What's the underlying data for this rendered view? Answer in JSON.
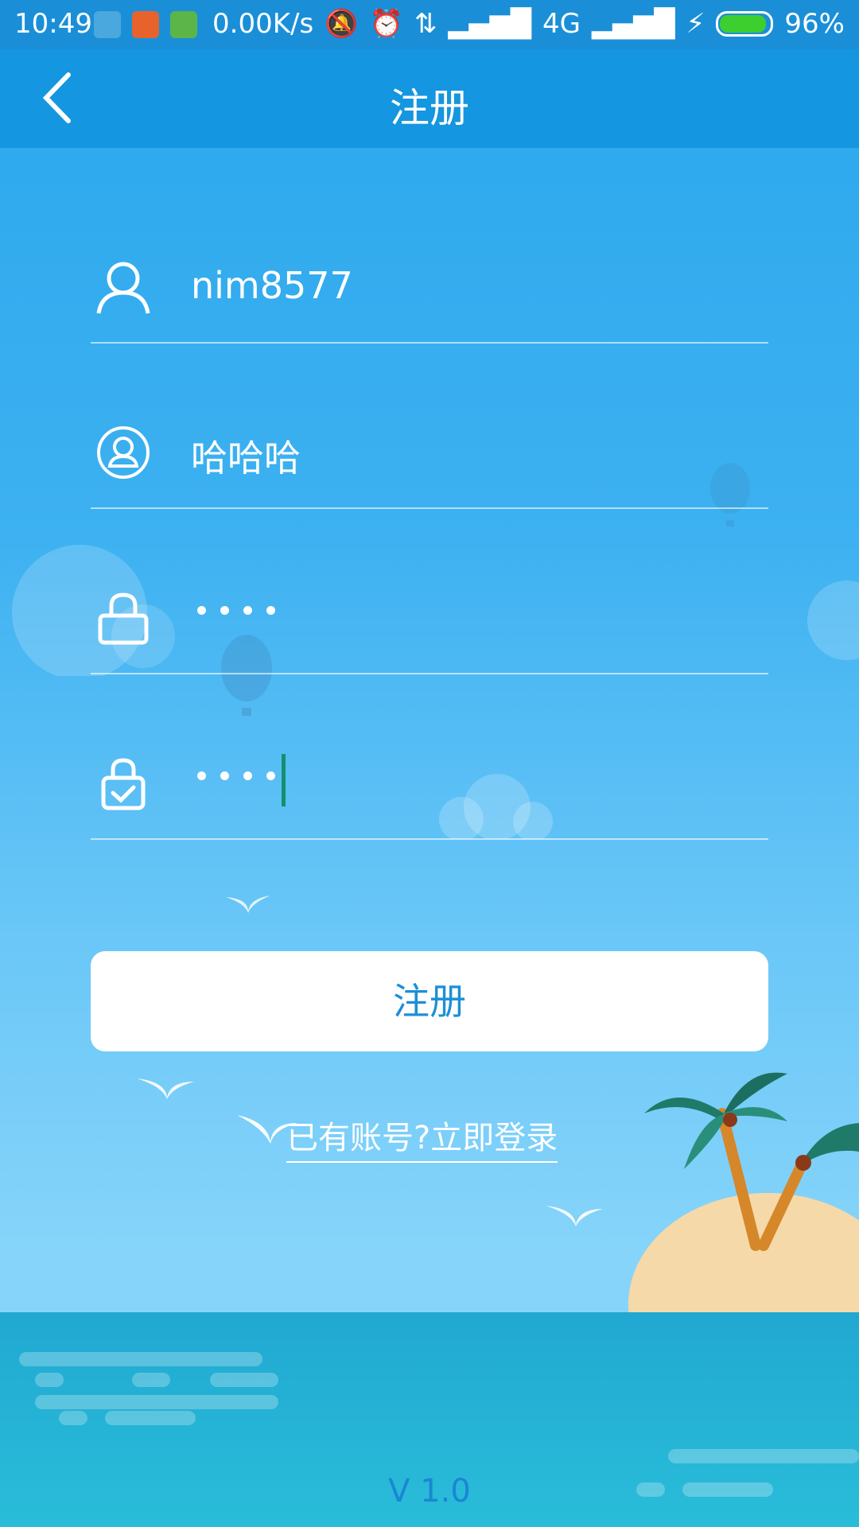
{
  "status_bar": {
    "time": "10:49",
    "speed": "0.00K/s",
    "network": "4G",
    "battery": "96%",
    "battery_level": 0.96
  },
  "nav": {
    "back_icon": "chevron-left-icon",
    "title": "注册"
  },
  "form": {
    "username": {
      "icon": "user-icon",
      "value": "nim8577"
    },
    "nickname": {
      "icon": "avatar-circle-icon",
      "value": "哈哈哈"
    },
    "password": {
      "icon": "lock-icon",
      "masked_length": 4
    },
    "confirm_password": {
      "icon": "lock-check-icon",
      "masked_length": 4
    }
  },
  "register_button": {
    "label": "注册"
  },
  "login_link": {
    "label": "已有账号?立即登录"
  },
  "footer": {
    "version": "V 1.0"
  },
  "colors": {
    "accent": "#1496e0",
    "button_text": "#1d8fd6",
    "caret": "#15906d"
  }
}
